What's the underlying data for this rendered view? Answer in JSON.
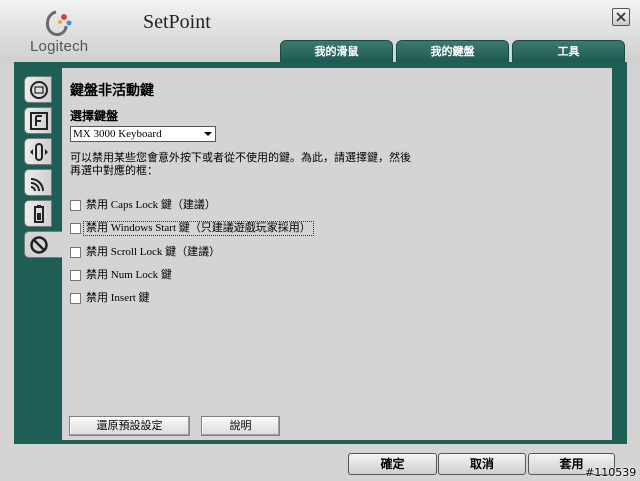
{
  "header": {
    "brand": "Logitech",
    "title": "SetPoint"
  },
  "tabs": [
    {
      "label": "我的滑鼠",
      "active": false
    },
    {
      "label": "我的鍵盤",
      "active": true
    },
    {
      "label": "工具",
      "active": false
    }
  ],
  "side_tabs": [
    "keyboard-icon",
    "function-key-icon",
    "scroll-icon",
    "wireless-signal-icon",
    "battery-icon",
    "disabled-icon"
  ],
  "main": {
    "heading": "鍵盤非活動鍵",
    "select_label": "選擇鍵盤",
    "keyboard_value": "MX 3000 Keyboard",
    "description": "可以禁用某些您會意外按下或者從不使用的鍵。為此，請選擇鍵，然後再選中對應的框：",
    "checkboxes": [
      {
        "label": "禁用 Caps Lock 鍵（建議）",
        "checked": false
      },
      {
        "label": "禁用 Windows Start 鍵（只建議遊戲玩家採用）",
        "checked": false
      },
      {
        "label": "禁用 Scroll Lock 鍵（建議）",
        "checked": false
      },
      {
        "label": "禁用 Num Lock 鍵",
        "checked": false
      },
      {
        "label": "禁用 Insert 鍵",
        "checked": false
      }
    ],
    "restore_button": "還原預設設定",
    "help_button": "說明"
  },
  "footer": {
    "ok": "確定",
    "cancel": "取消",
    "apply": "套用"
  },
  "watermark": "#110539",
  "colors": {
    "accent": "#1e5e55",
    "background": "#d4d4d4"
  }
}
